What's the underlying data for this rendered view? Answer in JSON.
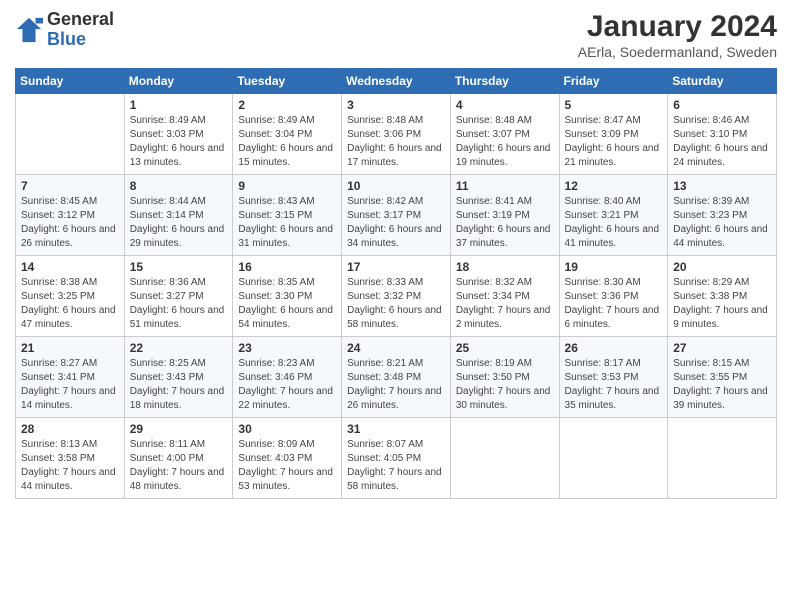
{
  "logo": {
    "general": "General",
    "blue": "Blue"
  },
  "header": {
    "month": "January 2024",
    "location": "AErla, Soedermanland, Sweden"
  },
  "days_of_week": [
    "Sunday",
    "Monday",
    "Tuesday",
    "Wednesday",
    "Thursday",
    "Friday",
    "Saturday"
  ],
  "weeks": [
    [
      {
        "day": "",
        "info": ""
      },
      {
        "day": "1",
        "info": "Sunrise: 8:49 AM\nSunset: 3:03 PM\nDaylight: 6 hours\nand 13 minutes."
      },
      {
        "day": "2",
        "info": "Sunrise: 8:49 AM\nSunset: 3:04 PM\nDaylight: 6 hours\nand 15 minutes."
      },
      {
        "day": "3",
        "info": "Sunrise: 8:48 AM\nSunset: 3:06 PM\nDaylight: 6 hours\nand 17 minutes."
      },
      {
        "day": "4",
        "info": "Sunrise: 8:48 AM\nSunset: 3:07 PM\nDaylight: 6 hours\nand 19 minutes."
      },
      {
        "day": "5",
        "info": "Sunrise: 8:47 AM\nSunset: 3:09 PM\nDaylight: 6 hours\nand 21 minutes."
      },
      {
        "day": "6",
        "info": "Sunrise: 8:46 AM\nSunset: 3:10 PM\nDaylight: 6 hours\nand 24 minutes."
      }
    ],
    [
      {
        "day": "7",
        "info": "Sunrise: 8:45 AM\nSunset: 3:12 PM\nDaylight: 6 hours\nand 26 minutes."
      },
      {
        "day": "8",
        "info": "Sunrise: 8:44 AM\nSunset: 3:14 PM\nDaylight: 6 hours\nand 29 minutes."
      },
      {
        "day": "9",
        "info": "Sunrise: 8:43 AM\nSunset: 3:15 PM\nDaylight: 6 hours\nand 31 minutes."
      },
      {
        "day": "10",
        "info": "Sunrise: 8:42 AM\nSunset: 3:17 PM\nDaylight: 6 hours\nand 34 minutes."
      },
      {
        "day": "11",
        "info": "Sunrise: 8:41 AM\nSunset: 3:19 PM\nDaylight: 6 hours\nand 37 minutes."
      },
      {
        "day": "12",
        "info": "Sunrise: 8:40 AM\nSunset: 3:21 PM\nDaylight: 6 hours\nand 41 minutes."
      },
      {
        "day": "13",
        "info": "Sunrise: 8:39 AM\nSunset: 3:23 PM\nDaylight: 6 hours\nand 44 minutes."
      }
    ],
    [
      {
        "day": "14",
        "info": "Sunrise: 8:38 AM\nSunset: 3:25 PM\nDaylight: 6 hours\nand 47 minutes."
      },
      {
        "day": "15",
        "info": "Sunrise: 8:36 AM\nSunset: 3:27 PM\nDaylight: 6 hours\nand 51 minutes."
      },
      {
        "day": "16",
        "info": "Sunrise: 8:35 AM\nSunset: 3:30 PM\nDaylight: 6 hours\nand 54 minutes."
      },
      {
        "day": "17",
        "info": "Sunrise: 8:33 AM\nSunset: 3:32 PM\nDaylight: 6 hours\nand 58 minutes."
      },
      {
        "day": "18",
        "info": "Sunrise: 8:32 AM\nSunset: 3:34 PM\nDaylight: 7 hours\nand 2 minutes."
      },
      {
        "day": "19",
        "info": "Sunrise: 8:30 AM\nSunset: 3:36 PM\nDaylight: 7 hours\nand 6 minutes."
      },
      {
        "day": "20",
        "info": "Sunrise: 8:29 AM\nSunset: 3:38 PM\nDaylight: 7 hours\nand 9 minutes."
      }
    ],
    [
      {
        "day": "21",
        "info": "Sunrise: 8:27 AM\nSunset: 3:41 PM\nDaylight: 7 hours\nand 14 minutes."
      },
      {
        "day": "22",
        "info": "Sunrise: 8:25 AM\nSunset: 3:43 PM\nDaylight: 7 hours\nand 18 minutes."
      },
      {
        "day": "23",
        "info": "Sunrise: 8:23 AM\nSunset: 3:46 PM\nDaylight: 7 hours\nand 22 minutes."
      },
      {
        "day": "24",
        "info": "Sunrise: 8:21 AM\nSunset: 3:48 PM\nDaylight: 7 hours\nand 26 minutes."
      },
      {
        "day": "25",
        "info": "Sunrise: 8:19 AM\nSunset: 3:50 PM\nDaylight: 7 hours\nand 30 minutes."
      },
      {
        "day": "26",
        "info": "Sunrise: 8:17 AM\nSunset: 3:53 PM\nDaylight: 7 hours\nand 35 minutes."
      },
      {
        "day": "27",
        "info": "Sunrise: 8:15 AM\nSunset: 3:55 PM\nDaylight: 7 hours\nand 39 minutes."
      }
    ],
    [
      {
        "day": "28",
        "info": "Sunrise: 8:13 AM\nSunset: 3:58 PM\nDaylight: 7 hours\nand 44 minutes."
      },
      {
        "day": "29",
        "info": "Sunrise: 8:11 AM\nSunset: 4:00 PM\nDaylight: 7 hours\nand 48 minutes."
      },
      {
        "day": "30",
        "info": "Sunrise: 8:09 AM\nSunset: 4:03 PM\nDaylight: 7 hours\nand 53 minutes."
      },
      {
        "day": "31",
        "info": "Sunrise: 8:07 AM\nSunset: 4:05 PM\nDaylight: 7 hours\nand 58 minutes."
      },
      {
        "day": "",
        "info": ""
      },
      {
        "day": "",
        "info": ""
      },
      {
        "day": "",
        "info": ""
      }
    ]
  ]
}
